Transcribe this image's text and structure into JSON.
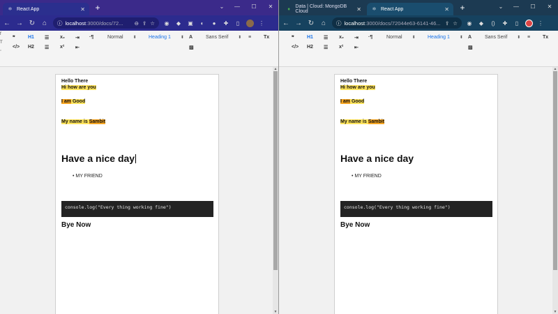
{
  "left": {
    "tab": {
      "title": "React App",
      "icon": "react-icon"
    },
    "address": {
      "host": "localhost",
      "path": ":3000/docs/72..."
    }
  },
  "right": {
    "tab1": {
      "title": "Data | Cloud: MongoDB Cloud",
      "icon": "mongodb-leaf-icon"
    },
    "tab2": {
      "title": "React App",
      "icon": "react-icon"
    },
    "address": {
      "host": "localhost",
      "path": ":3000/docs/72044e63-6141-46..."
    }
  },
  "toolbar": {
    "h1": "H1",
    "h2": "H2",
    "sub": "x₂",
    "sup": "x²",
    "normal": "Normal",
    "heading": "Heading 1",
    "font": "Sans Serif"
  },
  "doc": {
    "line1": "Hello There",
    "line2": "Hi how are you",
    "line3a": "I am",
    "line3b": " Good",
    "line4a": "My name is ",
    "line4b": "Sambit",
    "heading": "Have a nice day",
    "bullet": "• MY FRIEND",
    "code": "console.log(\"Every thing working fine\")",
    "bye": "Bye Now"
  },
  "colors": {
    "leftChrome": "#2c2b8e",
    "rightChrome": "#16425f",
    "highlightYellow": "#ffe45c",
    "highlightOrange": "#f6a623",
    "codeBg": "#232323"
  }
}
